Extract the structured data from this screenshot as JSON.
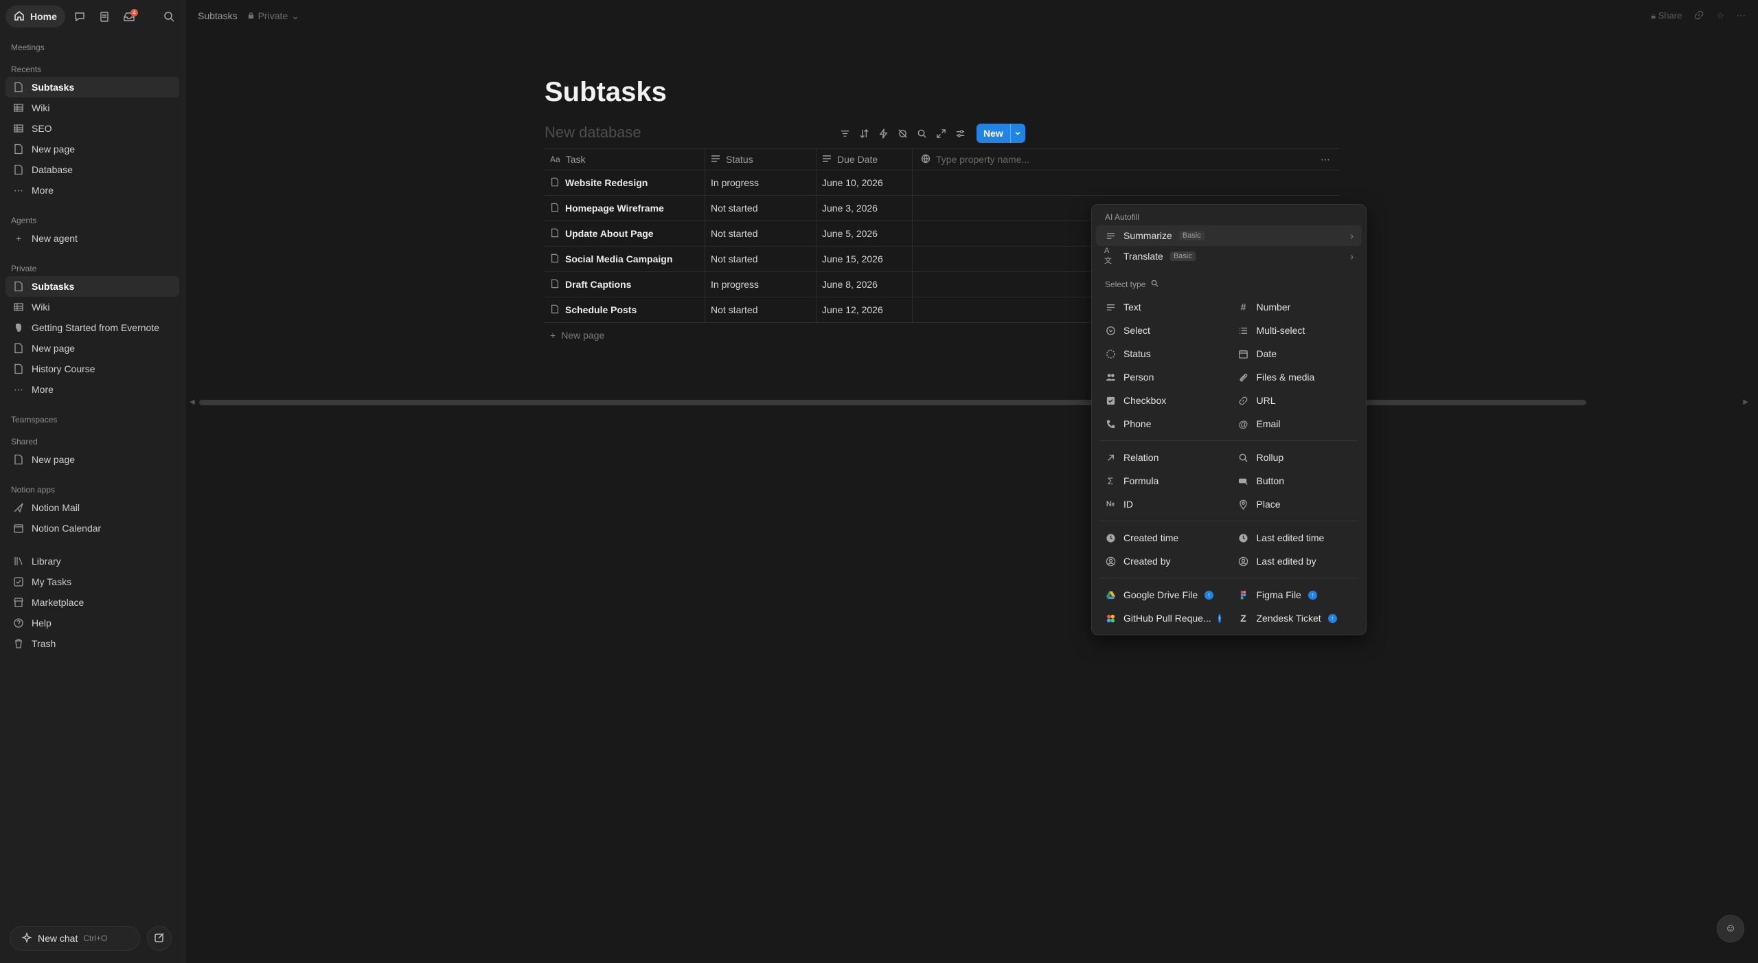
{
  "sidebar": {
    "home_label": "Home",
    "inbox_badge": "4",
    "meetings_label": "Meetings",
    "recents_label": "Recents",
    "recents": [
      {
        "label": "Subtasks",
        "icon": "page-icon"
      },
      {
        "label": "Wiki",
        "icon": "database-icon"
      },
      {
        "label": "SEO",
        "icon": "database-icon"
      },
      {
        "label": "New page",
        "icon": "page-icon"
      },
      {
        "label": "Database",
        "icon": "page-icon"
      },
      {
        "label": "More",
        "icon": "more-icon"
      }
    ],
    "agents_label": "Agents",
    "new_agent_label": "New agent",
    "private_label": "Private",
    "private": [
      {
        "label": "Subtasks",
        "icon": "page-icon"
      },
      {
        "label": "Wiki",
        "icon": "database-icon"
      },
      {
        "label": "Getting Started from Evernote",
        "icon": "evernote-icon"
      },
      {
        "label": "New page",
        "icon": "page-icon"
      },
      {
        "label": "History Course",
        "icon": "page-icon"
      },
      {
        "label": "More",
        "icon": "more-icon"
      }
    ],
    "teamspaces_label": "Teamspaces",
    "shared_label": "Shared",
    "shared": [
      {
        "label": "New page",
        "icon": "page-icon"
      }
    ],
    "apps_label": "Notion apps",
    "apps": [
      {
        "label": "Notion Mail",
        "icon": "mail-icon"
      },
      {
        "label": "Notion Calendar",
        "icon": "calendar-icon"
      }
    ],
    "footer": [
      {
        "label": "Library",
        "icon": "library-icon"
      },
      {
        "label": "My Tasks",
        "icon": "tasks-icon"
      },
      {
        "label": "Marketplace",
        "icon": "marketplace-icon"
      },
      {
        "label": "Help",
        "icon": "help-icon"
      },
      {
        "label": "Trash",
        "icon": "trash-icon"
      }
    ],
    "new_chat_label": "New chat",
    "new_chat_shortcut": "Ctrl+O"
  },
  "topbar": {
    "breadcrumb": "Subtasks",
    "privacy": "Private",
    "share_label": "Share"
  },
  "page": {
    "title": "Subtasks",
    "database_placeholder": "New database",
    "new_button": "New"
  },
  "table": {
    "columns": [
      "Task",
      "Status",
      "Due Date"
    ],
    "property_placeholder": "Type property name...",
    "rows": [
      {
        "task": "Website Redesign",
        "status": "In progress",
        "due": "June 10, 2026"
      },
      {
        "task": "Homepage Wireframe",
        "status": "Not started",
        "due": "June 3, 2026"
      },
      {
        "task": "Update About Page",
        "status": "Not started",
        "due": "June 5, 2026"
      },
      {
        "task": "Social Media Campaign",
        "status": "Not started",
        "due": "June 15, 2026"
      },
      {
        "task": "Draft Captions",
        "status": "In progress",
        "due": "June 8, 2026"
      },
      {
        "task": "Schedule Posts",
        "status": "Not started",
        "due": "June 12, 2026"
      }
    ],
    "add_row_label": "New page"
  },
  "dropdown": {
    "ai_label": "AI Autofill",
    "ai_items": [
      {
        "label": "Summarize",
        "tag": "Basic"
      },
      {
        "label": "Translate",
        "tag": "Basic"
      }
    ],
    "select_type_label": "Select type",
    "group1": [
      {
        "label": "Text",
        "icon": "text-icon"
      },
      {
        "label": "Number",
        "icon": "number-icon"
      },
      {
        "label": "Select",
        "icon": "select-icon"
      },
      {
        "label": "Multi-select",
        "icon": "multi-select-icon"
      },
      {
        "label": "Status",
        "icon": "status-icon"
      },
      {
        "label": "Date",
        "icon": "date-icon"
      },
      {
        "label": "Person",
        "icon": "person-icon"
      },
      {
        "label": "Files & media",
        "icon": "paperclip-icon"
      },
      {
        "label": "Checkbox",
        "icon": "checkbox-icon"
      },
      {
        "label": "URL",
        "icon": "link-icon"
      },
      {
        "label": "Phone",
        "icon": "phone-icon"
      },
      {
        "label": "Email",
        "icon": "at-icon"
      }
    ],
    "group2": [
      {
        "label": "Relation",
        "icon": "relation-icon"
      },
      {
        "label": "Rollup",
        "icon": "rollup-icon"
      },
      {
        "label": "Formula",
        "icon": "sigma-icon"
      },
      {
        "label": "Button",
        "icon": "button-icon"
      },
      {
        "label": "ID",
        "icon": "id-icon"
      },
      {
        "label": "Place",
        "icon": "pin-icon"
      }
    ],
    "group3": [
      {
        "label": "Created time",
        "icon": "clock-icon"
      },
      {
        "label": "Last edited time",
        "icon": "clock-icon"
      },
      {
        "label": "Created by",
        "icon": "user-circle-icon"
      },
      {
        "label": "Last edited by",
        "icon": "user-circle-icon"
      }
    ],
    "group4": [
      {
        "label": "Google Drive File",
        "icon": "google-drive-icon"
      },
      {
        "label": "Figma File",
        "icon": "figma-icon"
      },
      {
        "label": "GitHub Pull Reque...",
        "icon": "github-icon"
      },
      {
        "label": "Zendesk Ticket",
        "icon": "zendesk-icon"
      }
    ]
  }
}
